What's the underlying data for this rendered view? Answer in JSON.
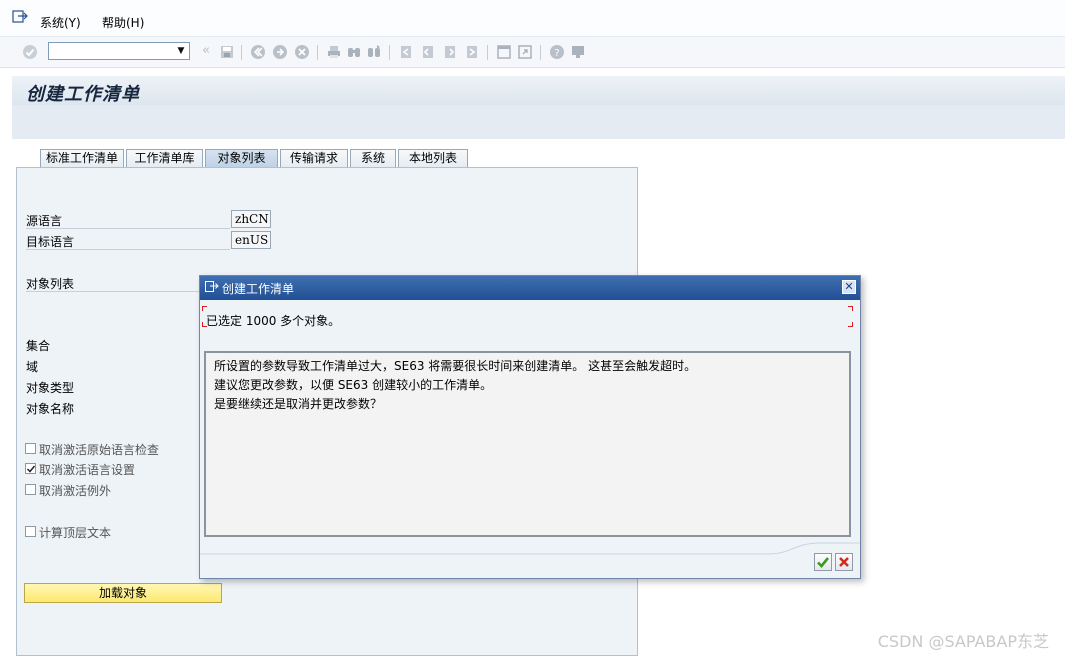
{
  "menubar": {
    "icon": "exit-menu-icon",
    "items": [
      {
        "label": "系统(Y)"
      },
      {
        "label": "帮助(H)"
      }
    ]
  },
  "toolbar": {
    "command_field_value": "",
    "icons": [
      "enter-icon",
      "save-icon",
      "back-icon",
      "exit-icon",
      "cancel-icon",
      "print-icon",
      "find-icon",
      "find-next-icon",
      "first-page-icon",
      "previous-page-icon",
      "next-page-icon",
      "last-page-icon",
      "create-session-icon",
      "shortcut-icon",
      "help-icon",
      "layout-menu-icon"
    ]
  },
  "page": {
    "title": "创建工作清单"
  },
  "tabs": [
    {
      "label": "标准工作清单",
      "active": false
    },
    {
      "label": "工作清单库",
      "active": false
    },
    {
      "label": "对象列表",
      "active": true
    },
    {
      "label": "传输请求",
      "active": false
    },
    {
      "label": "系统",
      "active": false
    },
    {
      "label": "本地列表",
      "active": false
    }
  ],
  "form": {
    "source_language_label": "源语言",
    "source_language_value": "zhCN",
    "target_language_label": "目标语言",
    "target_language_value": "enUS",
    "object_list_label": "对象列表",
    "collection_label": "集合",
    "domain_label": "域",
    "object_type_label": "对象类型",
    "object_name_label": "对象名称",
    "checkboxes": [
      {
        "label": "取消激活原始语言检查",
        "checked": false
      },
      {
        "label": "取消激活语言设置",
        "checked": true
      },
      {
        "label": "取消激活例外",
        "checked": false
      },
      {
        "label": "计算顶层文本",
        "checked": false
      }
    ],
    "load_button_label": "加载对象"
  },
  "dialog": {
    "title": "创建工作清单",
    "message": "已选定 1000 多个对象。",
    "lines": [
      "所设置的参数导致工作清单过大，SE63 将需要很长时间来创建清单。 这甚至会触发超时。",
      "建议您更改参数，以便 SE63 创建较小的工作清单。",
      "是要继续还是取消并更改参数？"
    ],
    "ok_icon": "checkmark-icon",
    "cancel_icon": "red-x-icon"
  },
  "watermark": "CSDN @SAPABAP东芝",
  "colors": {
    "dialog_title_bg": "#2a5aa0",
    "load_button_bg": "#fdf08a",
    "tab_active_bg": "#c9d9ea"
  }
}
